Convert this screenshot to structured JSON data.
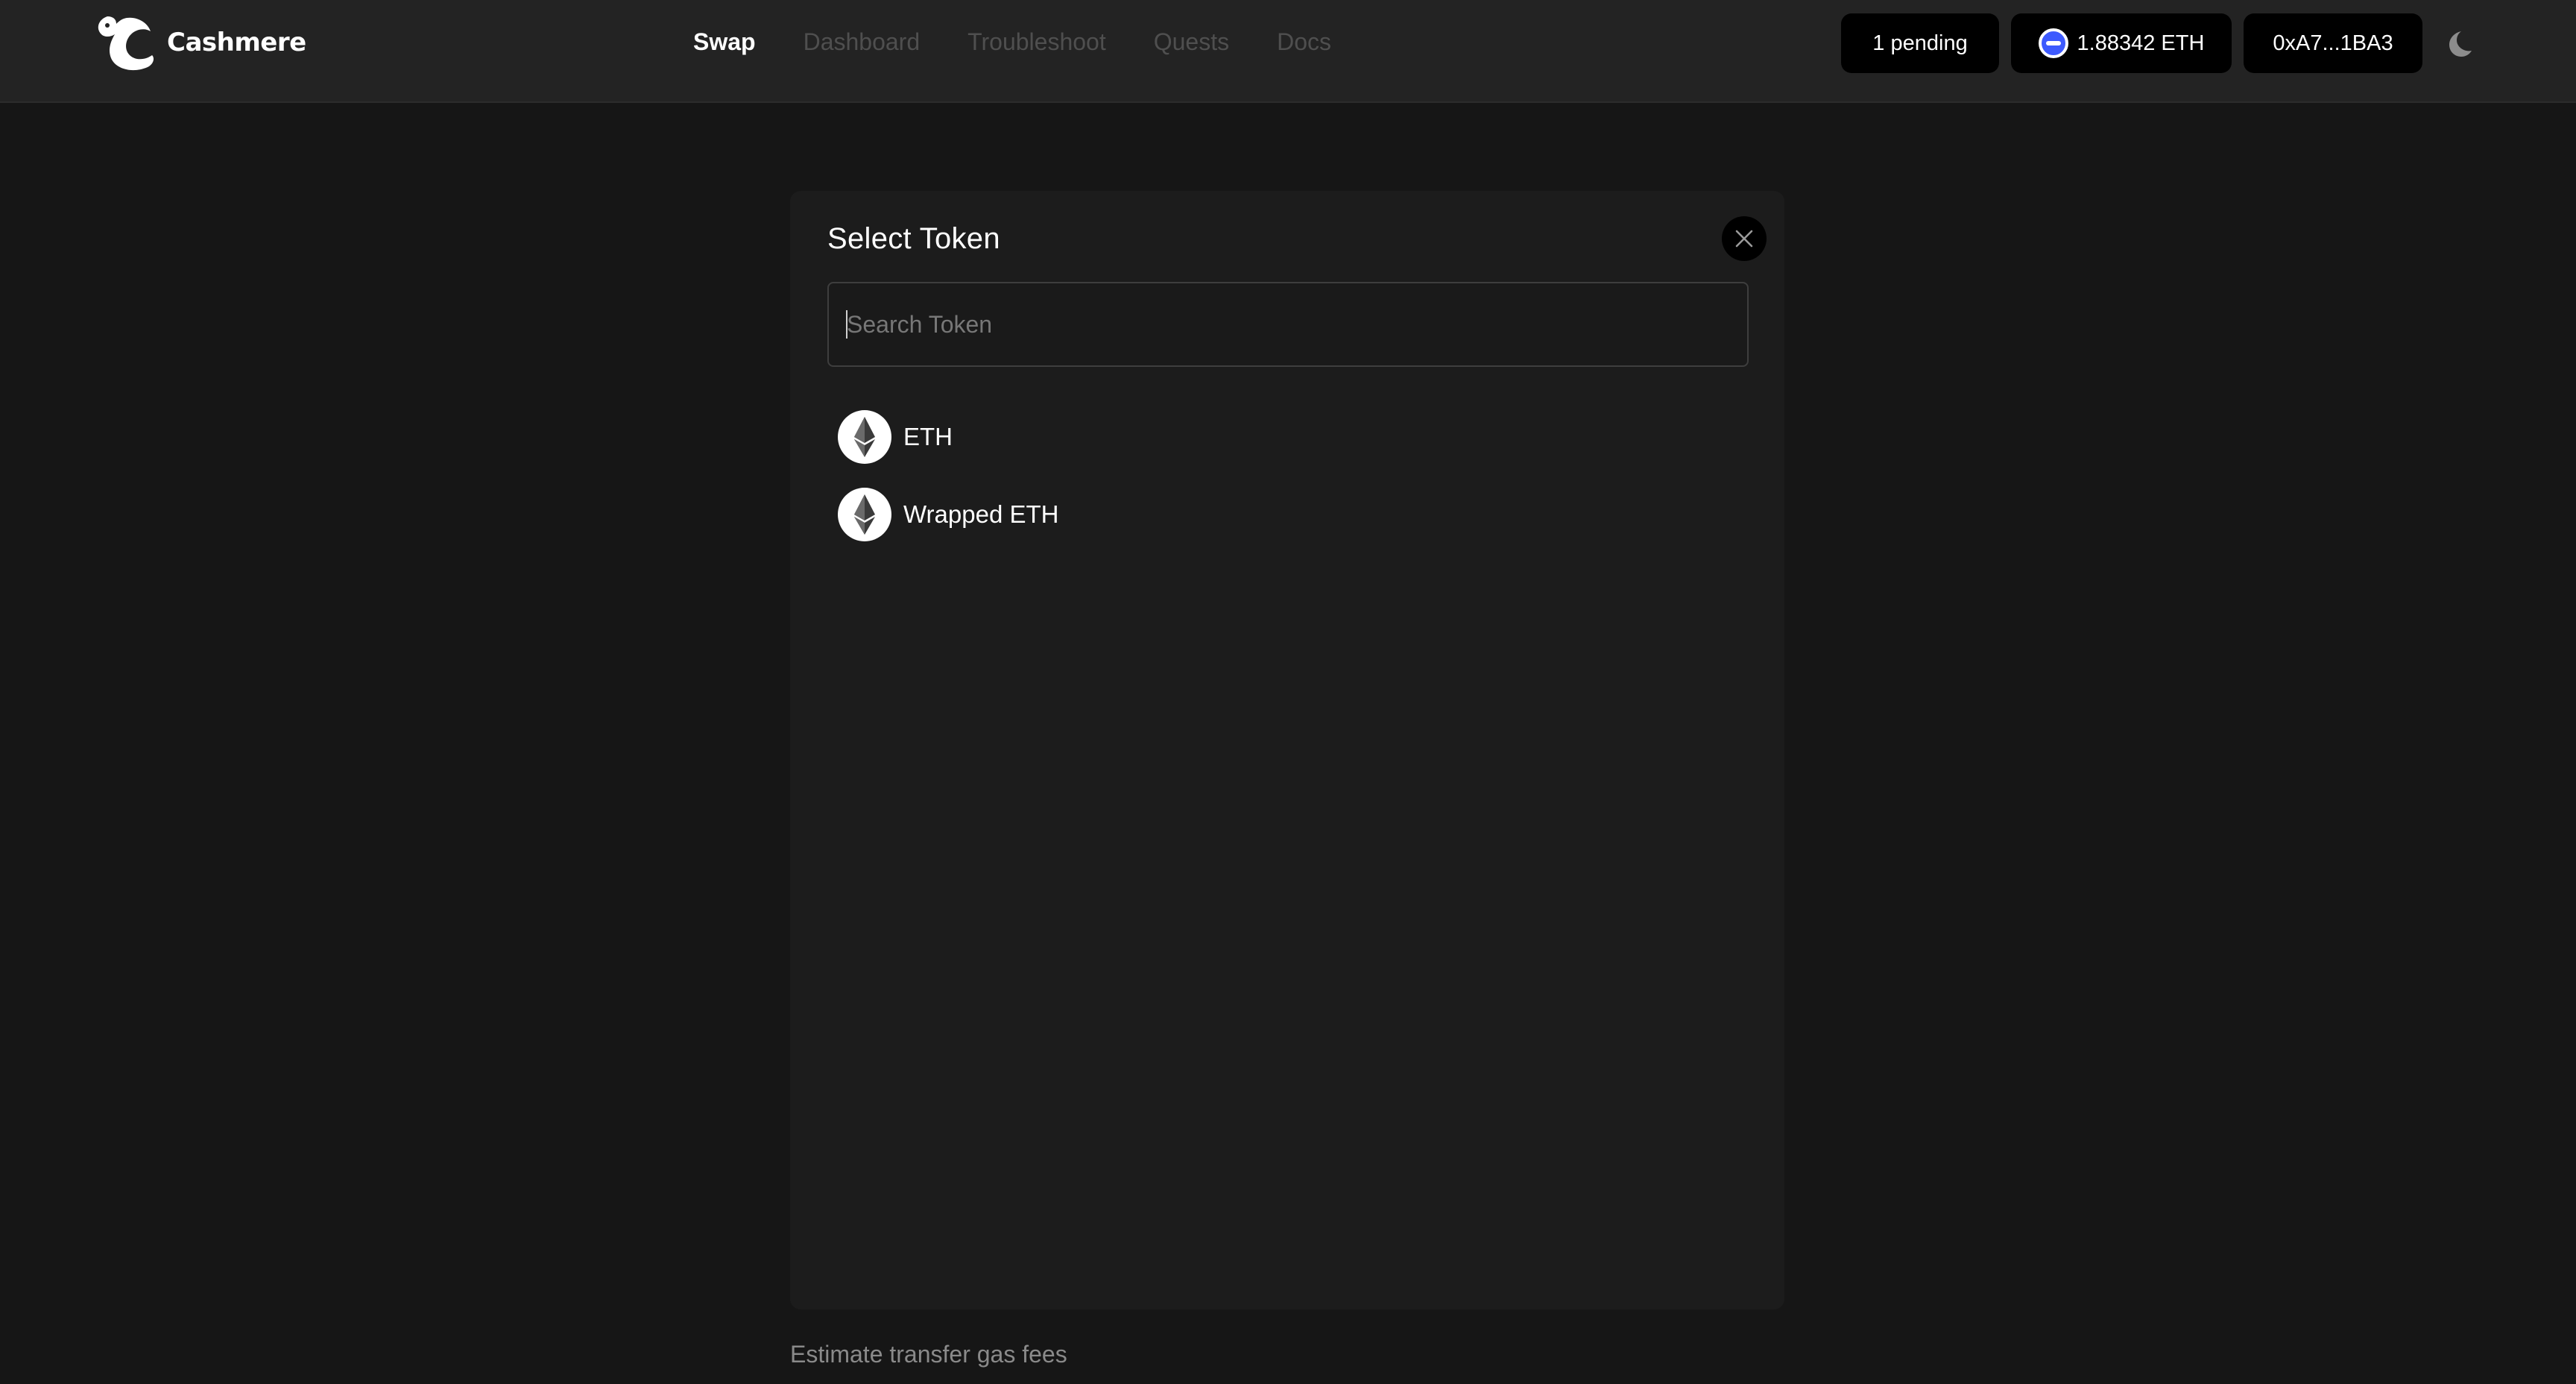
{
  "app": {
    "name": "Cashmere"
  },
  "nav": {
    "items": [
      {
        "label": "Swap",
        "active": true
      },
      {
        "label": "Dashboard",
        "active": false
      },
      {
        "label": "Troubleshoot",
        "active": false
      },
      {
        "label": "Quests",
        "active": false
      },
      {
        "label": "Docs",
        "active": false
      }
    ]
  },
  "header": {
    "pending_label": "1 pending",
    "balance_label": "1.88342 ETH",
    "address_label": "0xA7...1BA3",
    "chain_icon": "chain-icon",
    "theme_icon": "moon-icon"
  },
  "modal": {
    "title": "Select Token",
    "search": {
      "placeholder": "Search Token",
      "value": ""
    },
    "tokens": [
      {
        "name": "ETH",
        "icon": "ethereum-icon"
      },
      {
        "name": "Wrapped ETH",
        "icon": "ethereum-icon"
      }
    ]
  },
  "footer": {
    "gas_link": "Estimate transfer gas fees"
  },
  "colors": {
    "background": "#161616",
    "topbar": "#232323",
    "modal": "#1c1c1c",
    "pill": "#000000",
    "nav_inactive": "#4f4f4f",
    "chain_accent": "#3d5afe"
  }
}
